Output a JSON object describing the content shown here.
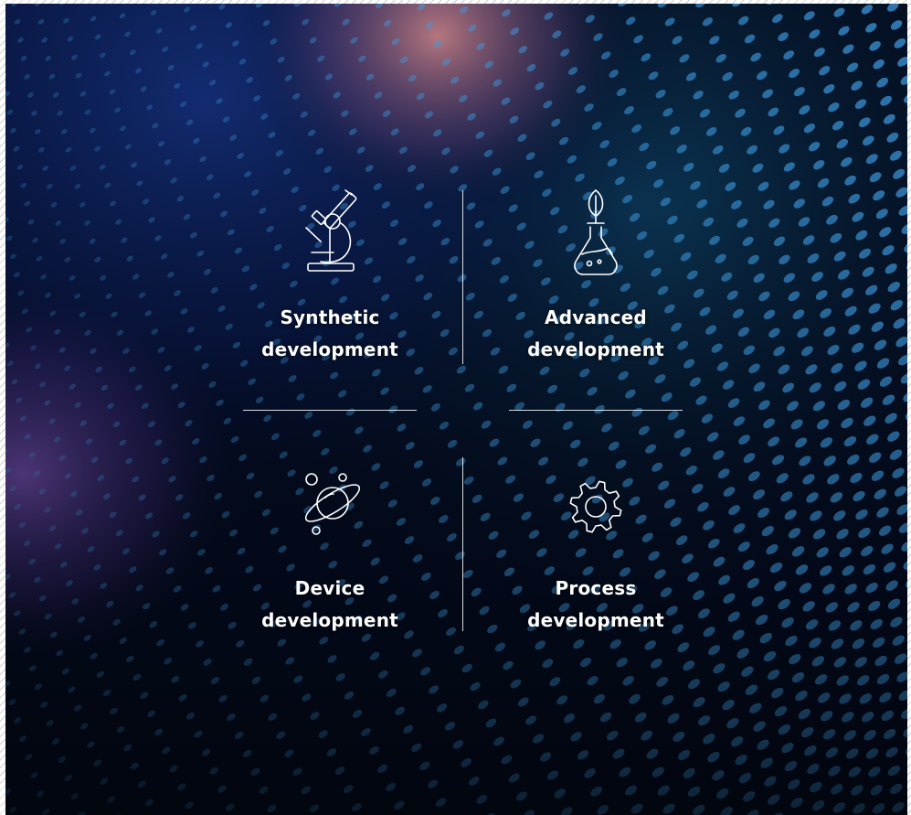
{
  "services": [
    {
      "icon": "microscope-icon",
      "line1": "Synthetic",
      "line2": "development"
    },
    {
      "icon": "flask-leaf-icon",
      "line1": "Advanced",
      "line2": "development"
    },
    {
      "icon": "planet-icon",
      "line1": "Device",
      "line2": "development"
    },
    {
      "icon": "gear-icon",
      "line1": "Process",
      "line2": "development"
    }
  ],
  "colors": {
    "background": "#030a1c",
    "text": "#ffffff",
    "dots": "#3f9fe6"
  }
}
